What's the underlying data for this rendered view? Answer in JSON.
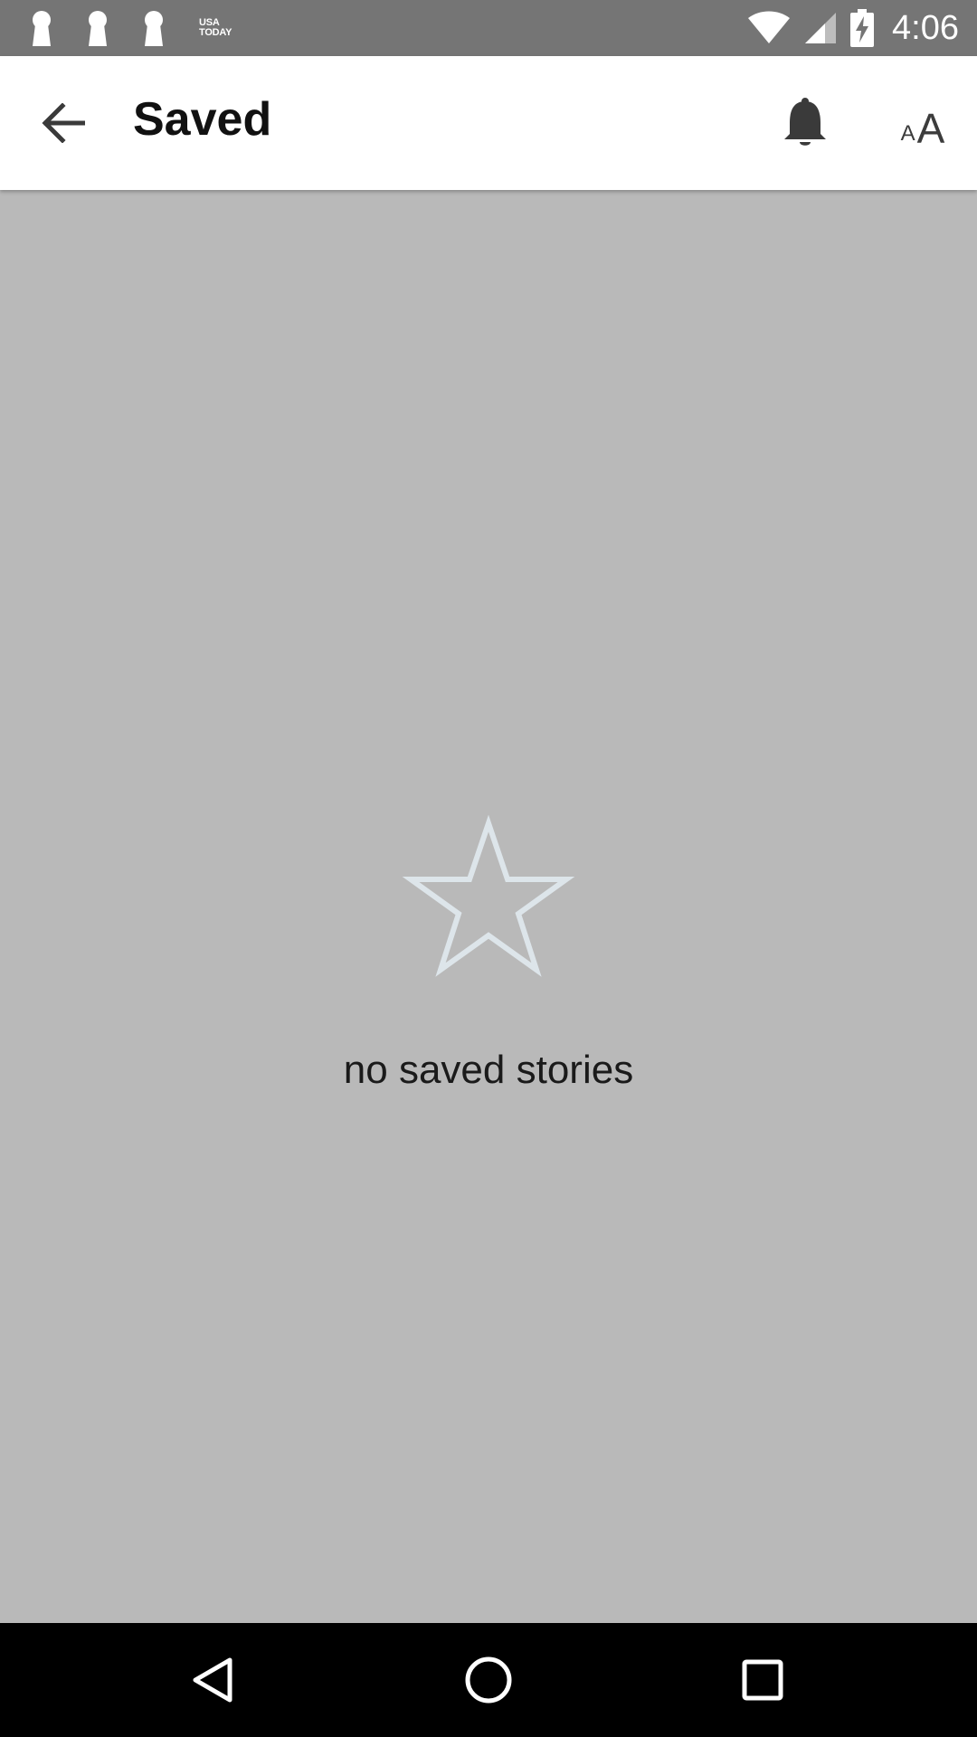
{
  "status_bar": {
    "notification_icons": [
      "keyhole-icon",
      "keyhole-icon",
      "keyhole-icon",
      "usa-today-logo"
    ],
    "usa_today_line1": "USA",
    "usa_today_line2": "TODAY",
    "time": "4:06",
    "icons": [
      "wifi-icon",
      "cell-signal-icon",
      "battery-charging-icon"
    ]
  },
  "app_bar": {
    "back_icon": "arrow-left-icon",
    "title": "Saved",
    "notifications_icon": "bell-icon",
    "font_size_small": "A",
    "font_size_large": "A"
  },
  "empty_state": {
    "icon": "star-outline-icon",
    "message": "no saved stories"
  },
  "nav_bar": {
    "icons": [
      "back-triangle-icon",
      "home-circle-icon",
      "recents-square-icon"
    ]
  },
  "colors": {
    "status_bar": "#757575",
    "app_bar": "#ffffff",
    "background": "#b9b9b9",
    "star_outline": "#dde5ea",
    "nav_bar": "#000000"
  }
}
